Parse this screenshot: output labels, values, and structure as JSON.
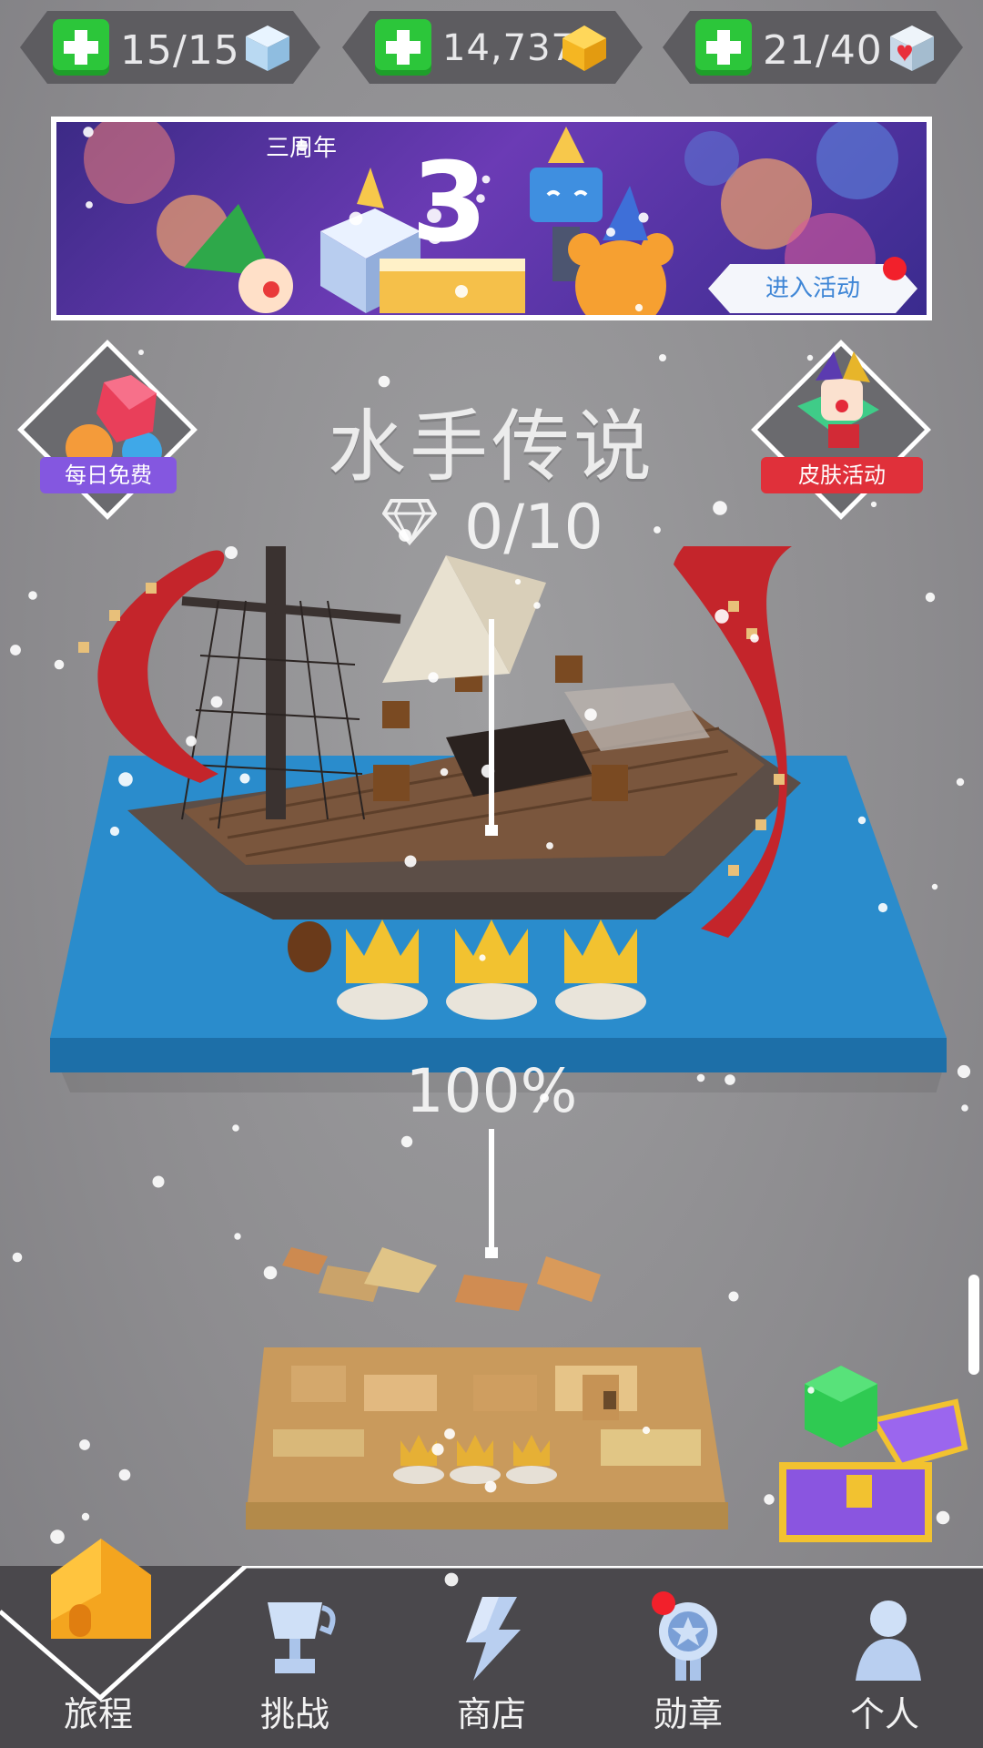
{
  "currencies": [
    {
      "value": "15/15",
      "icon": "ice-cube-icon"
    },
    {
      "value": "14,737",
      "icon": "gold-gem-icon"
    },
    {
      "value": "21/40",
      "icon": "heart-cube-icon"
    }
  ],
  "banner": {
    "title": "三周年",
    "button": "进入活动"
  },
  "daily_free": {
    "label": "每日免费"
  },
  "skin_event": {
    "label": "皮肤活动"
  },
  "level": {
    "title": "水手传说",
    "gems": "0/10",
    "progress_text": "100%",
    "progress": 1.0,
    "crowns_earned": 3
  },
  "nav": {
    "items": [
      {
        "label": "旅程",
        "icon": "home-icon"
      },
      {
        "label": "挑战",
        "icon": "trophy-icon"
      },
      {
        "label": "商店",
        "icon": "lightning-icon"
      },
      {
        "label": "勋章",
        "icon": "medal-icon"
      },
      {
        "label": "个人",
        "icon": "person-icon"
      }
    ]
  },
  "colors": {
    "background": "#8d8c8f",
    "plus_green": "#2cc63a",
    "badge_red": "#f2202b",
    "daily_purple": "#8457e0",
    "skin_red": "#e0303a",
    "water_blue": "#2a8ccc",
    "nav_dark": "#4a484c"
  }
}
